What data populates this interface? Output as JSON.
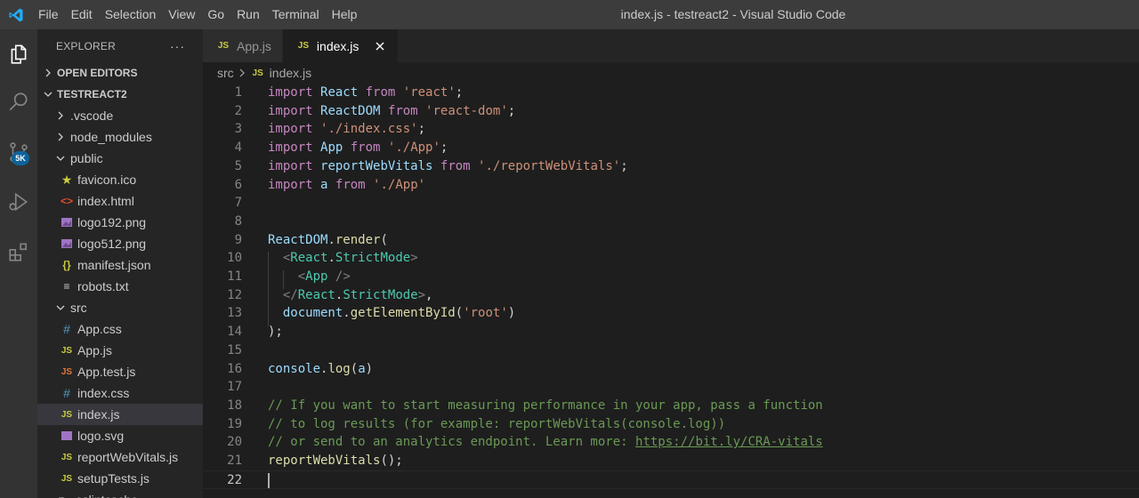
{
  "window": {
    "title": "index.js - testreact2 - Visual Studio Code",
    "menu": [
      "File",
      "Edit",
      "Selection",
      "View",
      "Go",
      "Run",
      "Terminal",
      "Help"
    ]
  },
  "activity_bar": {
    "items": [
      {
        "name": "explorer",
        "icon": "files-icon"
      },
      {
        "name": "search",
        "icon": "search-icon"
      },
      {
        "name": "source-control",
        "icon": "source-control-icon",
        "badge": "5K"
      },
      {
        "name": "run-debug",
        "icon": "run-debug-icon"
      },
      {
        "name": "extensions",
        "icon": "extensions-icon"
      }
    ]
  },
  "sidebar": {
    "title": "EXPLORER",
    "more": "···",
    "open_editors": "OPEN EDITORS",
    "project": "TESTREACT2",
    "tree": [
      {
        "label": ".vscode",
        "type": "folder",
        "expanded": false,
        "depth": 1
      },
      {
        "label": "node_modules",
        "type": "folder",
        "expanded": false,
        "depth": 1
      },
      {
        "label": "public",
        "type": "folder",
        "expanded": true,
        "depth": 1
      },
      {
        "label": "favicon.ico",
        "type": "star",
        "icon": "★",
        "depth": 2
      },
      {
        "label": "index.html",
        "type": "html",
        "icon": "<>",
        "depth": 2
      },
      {
        "label": "logo192.png",
        "type": "image",
        "depth": 2
      },
      {
        "label": "logo512.png",
        "type": "image",
        "depth": 2
      },
      {
        "label": "manifest.json",
        "type": "json",
        "icon": "{}",
        "depth": 2
      },
      {
        "label": "robots.txt",
        "type": "txt",
        "icon": "≡",
        "depth": 2
      },
      {
        "label": "src",
        "type": "folder",
        "expanded": true,
        "depth": 1
      },
      {
        "label": "App.css",
        "type": "css",
        "icon": "#",
        "depth": 2
      },
      {
        "label": "App.js",
        "type": "js",
        "icon": "JS",
        "depth": 2
      },
      {
        "label": "App.test.js",
        "type": "jsorange",
        "icon": "JS",
        "depth": 2
      },
      {
        "label": "index.css",
        "type": "css",
        "icon": "#",
        "depth": 2
      },
      {
        "label": "index.js",
        "type": "js",
        "icon": "JS",
        "depth": 2,
        "selected": true
      },
      {
        "label": "logo.svg",
        "type": "svg",
        "depth": 2
      },
      {
        "label": "reportWebVitals.js",
        "type": "js",
        "icon": "JS",
        "depth": 2
      },
      {
        "label": "setupTests.js",
        "type": "js",
        "icon": "JS",
        "depth": 2
      },
      {
        "label": ".eslintcache",
        "type": "txt",
        "icon": "≡",
        "depth": 1
      }
    ]
  },
  "tabs": [
    {
      "label": "App.js",
      "icon": "JS",
      "active": false
    },
    {
      "label": "index.js",
      "icon": "JS",
      "active": true,
      "close": "✕"
    }
  ],
  "breadcrumb": {
    "folder": "src",
    "file_icon": "JS",
    "file": "index.js"
  },
  "editor": {
    "current_line": 22,
    "lines": [
      {
        "n": "1",
        "tokens": [
          [
            "kw",
            "import"
          ],
          [
            "punc",
            " "
          ],
          [
            "var",
            "React"
          ],
          [
            "punc",
            " "
          ],
          [
            "kw",
            "from"
          ],
          [
            "punc",
            " "
          ],
          [
            "str",
            "'react'"
          ],
          [
            "punc",
            ";"
          ]
        ]
      },
      {
        "n": "2",
        "tokens": [
          [
            "kw",
            "import"
          ],
          [
            "punc",
            " "
          ],
          [
            "var",
            "ReactDOM"
          ],
          [
            "punc",
            " "
          ],
          [
            "kw",
            "from"
          ],
          [
            "punc",
            " "
          ],
          [
            "str",
            "'react-dom'"
          ],
          [
            "punc",
            ";"
          ]
        ]
      },
      {
        "n": "3",
        "tokens": [
          [
            "kw",
            "import"
          ],
          [
            "punc",
            " "
          ],
          [
            "str",
            "'./index.css'"
          ],
          [
            "punc",
            ";"
          ]
        ]
      },
      {
        "n": "4",
        "tokens": [
          [
            "kw",
            "import"
          ],
          [
            "punc",
            " "
          ],
          [
            "var",
            "App"
          ],
          [
            "punc",
            " "
          ],
          [
            "kw",
            "from"
          ],
          [
            "punc",
            " "
          ],
          [
            "str",
            "'./App'"
          ],
          [
            "punc",
            ";"
          ]
        ]
      },
      {
        "n": "5",
        "tokens": [
          [
            "kw",
            "import"
          ],
          [
            "punc",
            " "
          ],
          [
            "var",
            "reportWebVitals"
          ],
          [
            "punc",
            " "
          ],
          [
            "kw",
            "from"
          ],
          [
            "punc",
            " "
          ],
          [
            "str",
            "'./reportWebVitals'"
          ],
          [
            "punc",
            ";"
          ]
        ]
      },
      {
        "n": "6",
        "tokens": [
          [
            "kw",
            "import"
          ],
          [
            "punc",
            " "
          ],
          [
            "var",
            "a"
          ],
          [
            "punc",
            " "
          ],
          [
            "kw",
            "from"
          ],
          [
            "punc",
            " "
          ],
          [
            "str",
            "'./App'"
          ]
        ]
      },
      {
        "n": "7",
        "tokens": []
      },
      {
        "n": "8",
        "tokens": []
      },
      {
        "n": "9",
        "tokens": [
          [
            "var",
            "ReactDOM"
          ],
          [
            "punc",
            "."
          ],
          [
            "fn",
            "render"
          ],
          [
            "punc",
            "("
          ]
        ]
      },
      {
        "n": "10",
        "tokens": [
          [
            "punc",
            "  "
          ],
          [
            "tag",
            "<"
          ],
          [
            "comp",
            "React"
          ],
          [
            "punc",
            "."
          ],
          [
            "comp",
            "StrictMode"
          ],
          [
            "tag",
            ">"
          ]
        ]
      },
      {
        "n": "11",
        "tokens": [
          [
            "punc",
            "    "
          ],
          [
            "tag",
            "<"
          ],
          [
            "comp",
            "App"
          ],
          [
            "punc",
            " "
          ],
          [
            "tag",
            "/>"
          ]
        ]
      },
      {
        "n": "12",
        "tokens": [
          [
            "punc",
            "  "
          ],
          [
            "tag",
            "</"
          ],
          [
            "comp",
            "React"
          ],
          [
            "punc",
            "."
          ],
          [
            "comp",
            "StrictMode"
          ],
          [
            "tag",
            ">"
          ],
          [
            "punc",
            ","
          ]
        ]
      },
      {
        "n": "13",
        "tokens": [
          [
            "punc",
            "  "
          ],
          [
            "var",
            "document"
          ],
          [
            "punc",
            "."
          ],
          [
            "fn",
            "getElementById"
          ],
          [
            "punc",
            "("
          ],
          [
            "str",
            "'root'"
          ],
          [
            "punc",
            ")"
          ]
        ]
      },
      {
        "n": "14",
        "tokens": [
          [
            "punc",
            ");"
          ]
        ]
      },
      {
        "n": "15",
        "tokens": []
      },
      {
        "n": "16",
        "tokens": [
          [
            "var",
            "console"
          ],
          [
            "punc",
            "."
          ],
          [
            "fn",
            "log"
          ],
          [
            "punc",
            "("
          ],
          [
            "var",
            "a"
          ],
          [
            "punc",
            ")"
          ]
        ]
      },
      {
        "n": "17",
        "tokens": []
      },
      {
        "n": "18",
        "tokens": [
          [
            "cmt",
            "// If you want to start measuring performance in your app, pass a function"
          ]
        ]
      },
      {
        "n": "19",
        "tokens": [
          [
            "cmt",
            "// to log results (for example: reportWebVitals(console.log))"
          ]
        ]
      },
      {
        "n": "20",
        "tokens": [
          [
            "cmt",
            "// or send to an analytics endpoint. Learn more: "
          ],
          [
            "link",
            "https://bit.ly/CRA-vitals"
          ]
        ]
      },
      {
        "n": "21",
        "tokens": [
          [
            "fn",
            "reportWebVitals"
          ],
          [
            "punc",
            "();"
          ]
        ]
      },
      {
        "n": "22",
        "tokens": []
      }
    ]
  },
  "colors": {
    "accent": "#0e639c",
    "keyword": "#c586c0",
    "variable": "#9cdcfe",
    "string": "#ce9178",
    "function": "#dcdcaa",
    "component": "#4ec9b0",
    "comment": "#6a9955"
  }
}
